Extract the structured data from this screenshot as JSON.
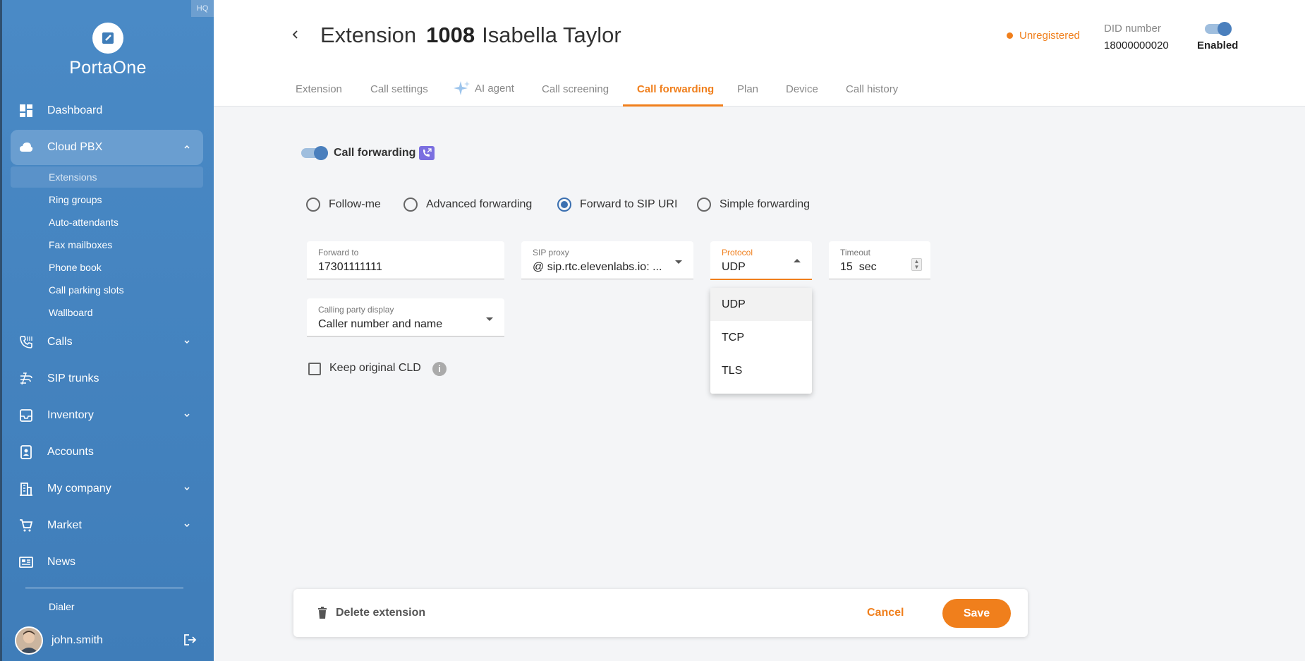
{
  "sidebar": {
    "hq_badge": "HQ",
    "logo_text": "PortaOne",
    "nav": {
      "dashboard": "Dashboard",
      "cloud_pbx": "Cloud PBX",
      "calls": "Calls",
      "sip_trunks": "SIP trunks",
      "inventory": "Inventory",
      "accounts": "Accounts",
      "my_company": "My company",
      "market": "Market",
      "news": "News"
    },
    "sub": {
      "extensions": "Extensions",
      "ring_groups": "Ring groups",
      "auto_attendants": "Auto-attendants",
      "fax_mailboxes": "Fax mailboxes",
      "phone_book": "Phone book",
      "call_parking_slots": "Call parking slots",
      "wallboard": "Wallboard"
    },
    "dialer": "Dialer",
    "username": "john.smith"
  },
  "header": {
    "title_prefix": "Extension",
    "ext_number": "1008",
    "ext_name": "Isabella Taylor",
    "status": "Unregistered",
    "did_label": "DID number",
    "did_value": "18000000020",
    "enabled_label": "Enabled",
    "tabs": {
      "extension": "Extension",
      "call_settings": "Call settings",
      "ai_agent": "AI agent",
      "call_screening": "Call screening",
      "call_forwarding": "Call forwarding",
      "plan": "Plan",
      "device": "Device",
      "call_history": "Call history"
    }
  },
  "form": {
    "cf_label": "Call forwarding",
    "modes": {
      "follow_me": "Follow-me",
      "advanced": "Advanced forwarding",
      "sip_uri": "Forward to SIP URI",
      "simple": "Simple forwarding"
    },
    "forward_to": {
      "label": "Forward to",
      "value": "17301111111"
    },
    "sip_proxy": {
      "label": "SIP proxy",
      "value": "@ sip.rtc.elevenlabs.io: ..."
    },
    "protocol": {
      "label": "Protocol",
      "value": "UDP",
      "options": [
        "UDP",
        "TCP",
        "TLS"
      ]
    },
    "timeout": {
      "label": "Timeout",
      "value": "15",
      "unit": "sec"
    },
    "calling_party": {
      "label": "Calling party display",
      "value": "Caller number and name"
    },
    "keep_cld": "Keep original CLD"
  },
  "footer": {
    "delete": "Delete extension",
    "cancel": "Cancel",
    "save": "Save"
  },
  "colors": {
    "accent": "#f07f1c",
    "sidebar": "#4a8ac6"
  }
}
